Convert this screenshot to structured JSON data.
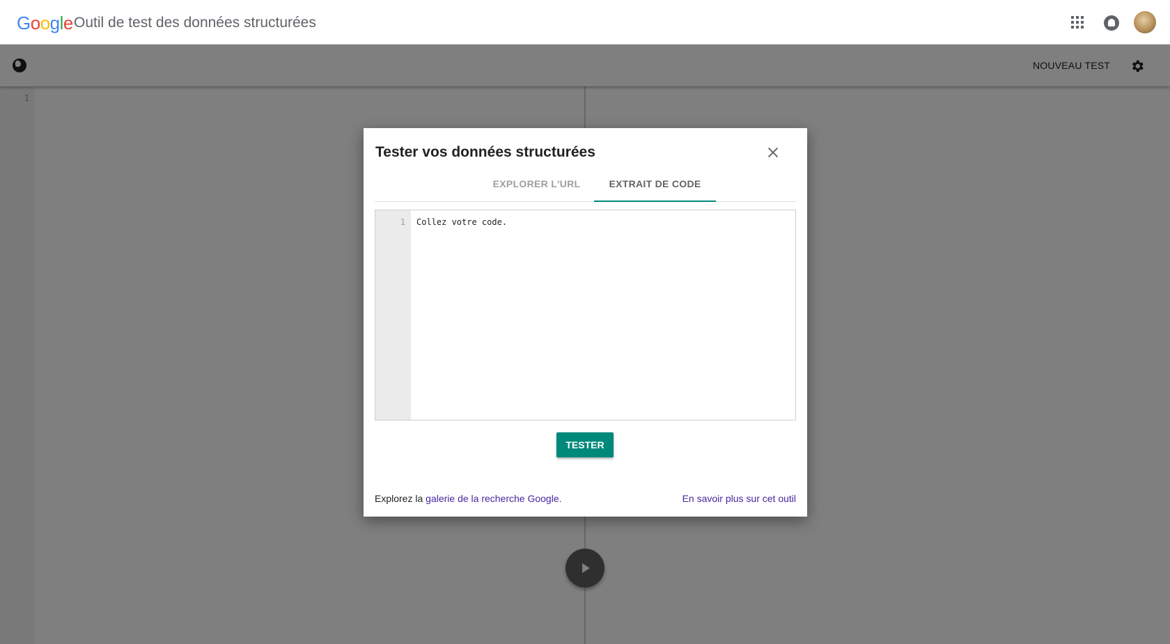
{
  "appbar": {
    "logo_letters": [
      {
        "char": "G",
        "color": "#4285F4"
      },
      {
        "char": "o",
        "color": "#EA4335"
      },
      {
        "char": "o",
        "color": "#FBBC05"
      },
      {
        "char": "g",
        "color": "#4285F4"
      },
      {
        "char": "l",
        "color": "#34A853"
      },
      {
        "char": "e",
        "color": "#EA4335"
      }
    ],
    "title": "Outil de test des données structurées",
    "icons": [
      "apps-icon",
      "notifications-icon",
      "avatar"
    ]
  },
  "toolbar": {
    "new_test_label": "NOUVEAU TEST",
    "icons": [
      "globe-icon",
      "gear-icon"
    ]
  },
  "editor": {
    "line_number": "1"
  },
  "dialog": {
    "title": "Tester vos données structurées",
    "tabs": [
      {
        "label": "EXPLORER L'URL",
        "active": false
      },
      {
        "label": "EXTRAIT DE CODE",
        "active": true
      }
    ],
    "code": {
      "line_number": "1",
      "placeholder": "Collez votre code."
    },
    "tester_label": "TESTER",
    "footer": {
      "prefix": "Explorez la ",
      "gallery_link": "galerie de la recherche Google.",
      "learn_more": "En savoir plus sur cet outil"
    }
  },
  "colors": {
    "accent": "#00897b",
    "link": "#4527a0",
    "overlay": "rgba(0,0,0,0.5)"
  }
}
